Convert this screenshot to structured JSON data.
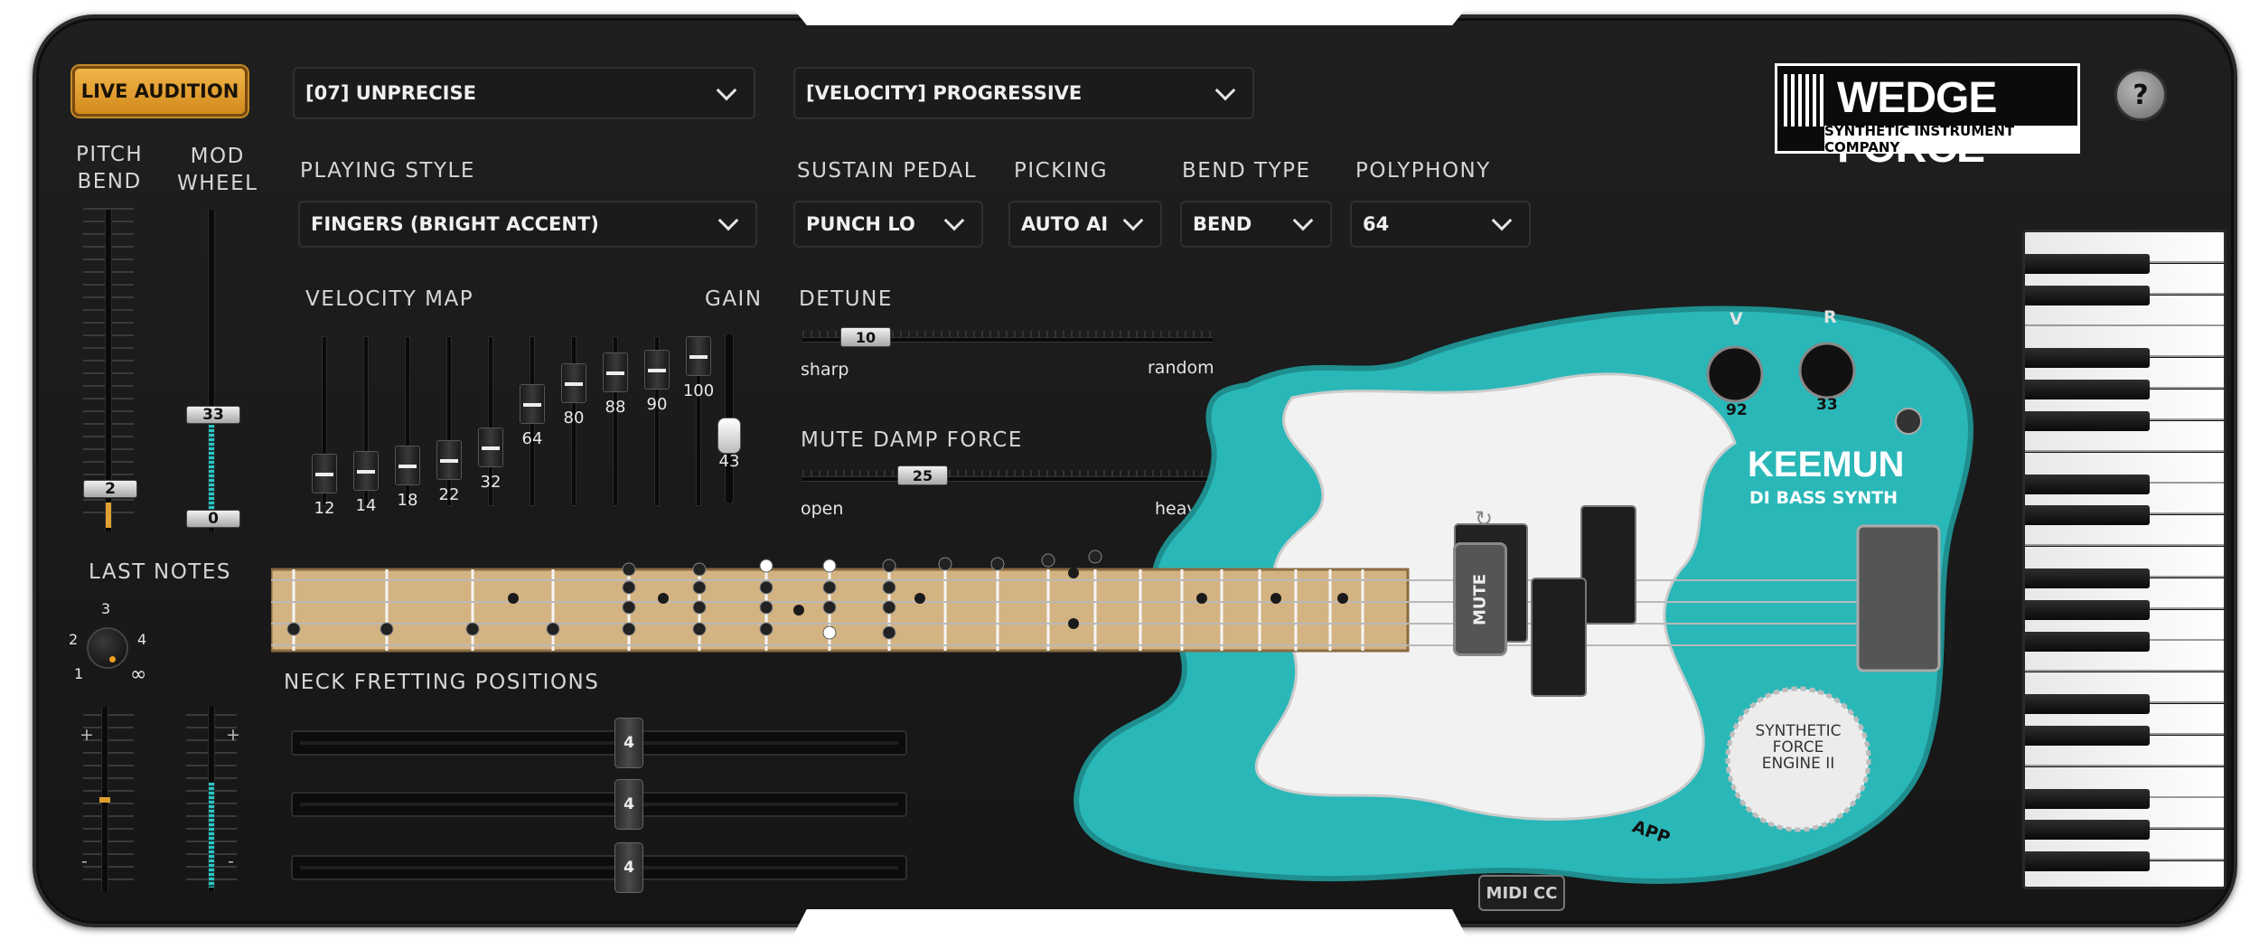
{
  "header": {
    "live_audition": "LIVE AUDITION",
    "preset_dropdown": "[07] UNPRECISE",
    "velocity_dropdown": "[VELOCITY] PROGRESSIVE"
  },
  "brand": {
    "name": "WEDGE FORCE",
    "tagline": "SYNTHETIC INSTRUMENT COMPANY",
    "help": "?"
  },
  "left": {
    "pitch_bend_label": "PITCH\nBEND",
    "mod_wheel_label": "MOD\nWHEEL",
    "pitch_bend_value": "2",
    "mod_wheel_value_top": "33",
    "mod_wheel_value_bottom": "0",
    "last_label": "LAST",
    "notes_label": "NOTES",
    "dial_marks": [
      "1",
      "2",
      "3",
      "4",
      "∞"
    ],
    "plus": "+",
    "minus": "-"
  },
  "controls": {
    "playing_style_label": "PLAYING STYLE",
    "playing_style_value": "FINGERS (BRIGHT ACCENT)",
    "sustain_label": "SUSTAIN PEDAL",
    "sustain_value": "PUNCH LO",
    "picking_label": "PICKING",
    "picking_value": "AUTO AI",
    "bend_label": "BEND TYPE",
    "bend_value": "BEND",
    "polyphony_label": "POLYPHONY",
    "polyphony_value": "64"
  },
  "velocity_map": {
    "label": "VELOCITY MAP",
    "gain_label": "GAIN",
    "values": [
      "12",
      "14",
      "18",
      "22",
      "32",
      "64",
      "80",
      "88",
      "90",
      "100"
    ],
    "levels": [
      12,
      14,
      18,
      22,
      32,
      64,
      80,
      88,
      90,
      100
    ],
    "gain_value": "43",
    "gain_level": 43
  },
  "detune": {
    "label": "DETUNE",
    "value": "10",
    "level": 10,
    "min_label": "sharp",
    "max_label": "random"
  },
  "mute_damp": {
    "label": "MUTE DAMP FORCE",
    "value": "25",
    "level": 25,
    "min_label": "open",
    "max_label": "heavy"
  },
  "neck": {
    "label": "NECK FRETTING POSITIONS",
    "positions": [
      "4",
      "4",
      "4"
    ]
  },
  "bass": {
    "model": "KEEMUN",
    "subtitle": "DI BASS SYNTH",
    "mute_label": "MUTE",
    "knob_v_label": "V",
    "knob_r_label": "R",
    "knob_v_value": "92",
    "knob_r_value": "33",
    "badge": "SYNTHETIC\nFORCE\nENGINE II",
    "badge_line1": "SYNTHETIC",
    "badge_line2": "FORCE",
    "badge_line3": "ENGINE II",
    "app": "APP",
    "accent": "#2ab7b8"
  },
  "footer": {
    "midi_cc": "MIDI CC"
  }
}
